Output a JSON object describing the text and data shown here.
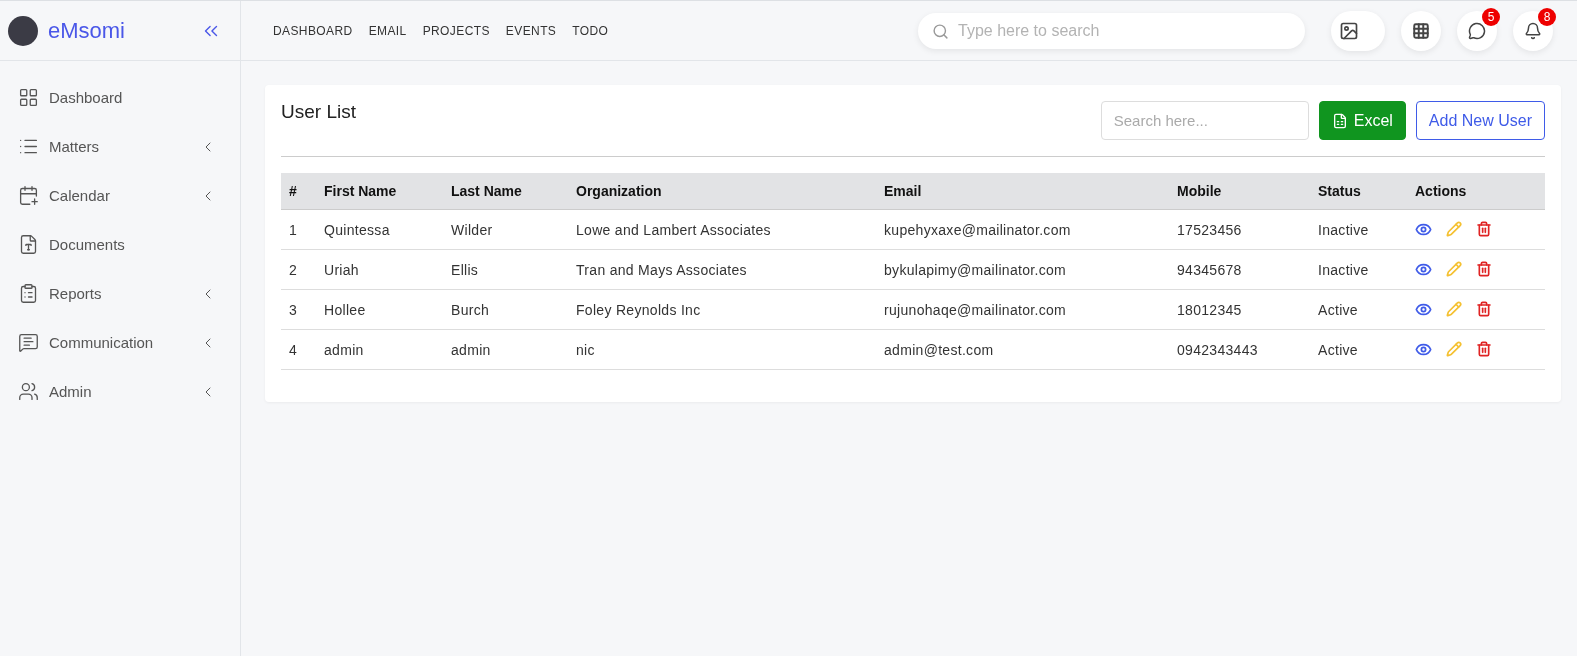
{
  "brand": {
    "name": "eMsomi"
  },
  "top_nav": [
    "DASHBOARD",
    "EMAIL",
    "PROJECTS",
    "EVENTS",
    "TODO"
  ],
  "search": {
    "placeholder": "Type here to search"
  },
  "header_actions": [
    {
      "kind": "image"
    },
    {
      "kind": "apps"
    },
    {
      "kind": "messenger",
      "badge": "5"
    },
    {
      "kind": "bell",
      "badge": "8"
    }
  ],
  "sidebar": {
    "items": [
      {
        "kind": "dashboard",
        "label": "Dashboard",
        "has_submenu": false
      },
      {
        "kind": "list",
        "label": "Matters",
        "has_submenu": true
      },
      {
        "kind": "calendar",
        "label": "Calendar",
        "has_submenu": true
      },
      {
        "kind": "document",
        "label": "Documents",
        "has_submenu": false
      },
      {
        "kind": "report",
        "label": "Reports",
        "has_submenu": true
      },
      {
        "kind": "chat",
        "label": "Communication",
        "has_submenu": true
      },
      {
        "kind": "users",
        "label": "Admin",
        "has_submenu": true
      }
    ]
  },
  "card": {
    "title": "User List",
    "search": {
      "placeholder": "Search here..."
    },
    "buttons": [
      {
        "kind": "excel",
        "label": "Excel"
      },
      {
        "kind": "outline",
        "label": "Add New User"
      }
    ]
  },
  "table": {
    "columns": [
      "#",
      "First Name",
      "Last Name",
      "Organization",
      "Email",
      "Mobile",
      "Status",
      "Actions"
    ],
    "rows": [
      [
        "1",
        "Quintessa",
        "Wilder",
        "Lowe and Lambert Associates",
        "kupehyxaxe@mailinator.com",
        "17523456",
        "Inactive"
      ],
      [
        "2",
        "Uriah",
        "Ellis",
        "Tran and Mays Associates",
        "bykulapimy@mailinator.com",
        "94345678",
        "Inactive"
      ],
      [
        "3",
        "Hollee",
        "Burch",
        "Foley Reynolds Inc",
        "rujunohaqe@mailinator.com",
        "18012345",
        "Active"
      ],
      [
        "4",
        "admin",
        "admin",
        "nic",
        "admin@test.com",
        "0942343443",
        "Active"
      ]
    ]
  }
}
